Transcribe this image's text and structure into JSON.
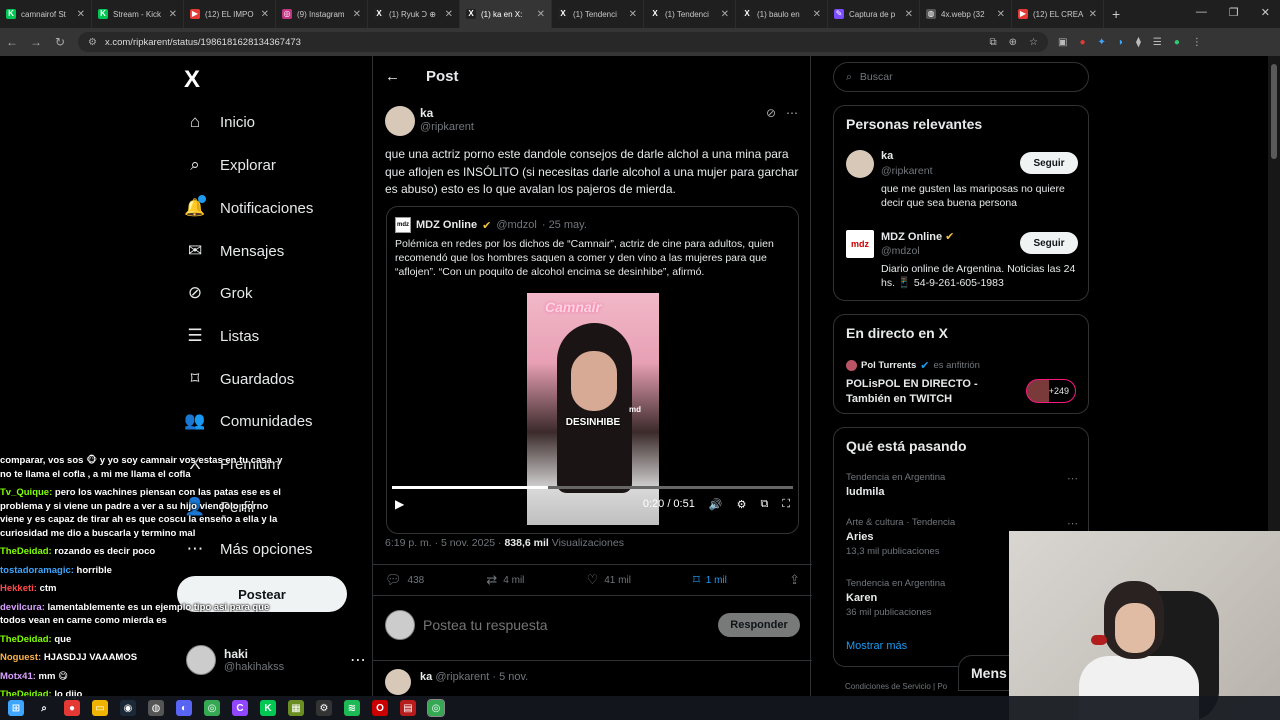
{
  "browser": {
    "tabs": [
      {
        "title": "camnairof St",
        "color": "#00c853",
        "glyph": "K"
      },
      {
        "title": "Stream - Kick",
        "color": "#00c853",
        "glyph": "K"
      },
      {
        "title": "(12) EL IMPO",
        "color": "#e53935",
        "glyph": "▶"
      },
      {
        "title": "(9) Instagram",
        "color": "#c13584",
        "glyph": "◎"
      },
      {
        "title": "(1) Ryuk Ↄ ⊕",
        "color": "#222222",
        "glyph": "X"
      },
      {
        "title": "(1) ka en X:",
        "color": "#222222",
        "glyph": "X",
        "active": true
      },
      {
        "title": "(1) Tendenci",
        "color": "#222222",
        "glyph": "X"
      },
      {
        "title": "(1) Tendenci",
        "color": "#222222",
        "glyph": "X"
      },
      {
        "title": "(1) baulo en",
        "color": "#222222",
        "glyph": "X"
      },
      {
        "title": "Captura de p",
        "color": "#7c4dff",
        "glyph": "✎"
      },
      {
        "title": "4x.webp (32",
        "color": "#555555",
        "glyph": "◍"
      },
      {
        "title": "(12) EL CREA",
        "color": "#e53935",
        "glyph": "▶"
      }
    ],
    "new_tab": "+",
    "window_controls": [
      "—",
      "❐",
      "✕"
    ],
    "url": "x.com/ripkarent/status/1986181628134367473"
  },
  "nav": {
    "logo": "X",
    "items": [
      {
        "label": "Inicio",
        "icon": "⌂",
        "name": "home"
      },
      {
        "label": "Explorar",
        "icon": "⌕",
        "name": "explore"
      },
      {
        "label": "Notificaciones",
        "icon": "🔔",
        "name": "notifications"
      },
      {
        "label": "Mensajes",
        "icon": "✉",
        "name": "messages"
      },
      {
        "label": "Grok",
        "icon": "⊘",
        "name": "grok"
      },
      {
        "label": "Listas",
        "icon": "☰",
        "name": "lists"
      },
      {
        "label": "Guardados",
        "icon": "⌑",
        "name": "bookmarks"
      },
      {
        "label": "Comunidades",
        "icon": "👥",
        "name": "communities"
      },
      {
        "label": "Premium",
        "icon": "X",
        "name": "premium"
      },
      {
        "label": "Perfil",
        "icon": "👤",
        "name": "profile"
      },
      {
        "label": "Más opciones",
        "icon": "⋯",
        "name": "more"
      }
    ],
    "post_button": "Postear",
    "profile": {
      "name": "haki",
      "handle": "@hakihakss",
      "more": "⋯"
    }
  },
  "chat": [
    {
      "user": "",
      "text": "comparar, vos sos 🐵 y yo soy camnair vos estas en tu casa, y no te llama el cofla , a mi me llama el cofla",
      "cls": ""
    },
    {
      "user": "Tv_Quique:",
      "text": "pero los wachines piensan con las patas ese es el problema y si viene un padre a ver a su hijo viendolo porno viene y es capaz de tirar ah es que coscu la enseño a ella y la curiosidad me dio a buscarla y termino mal",
      "cls": "cu-green"
    },
    {
      "user": "TheDeidad:",
      "text": "rozando es decir poco",
      "cls": "cu-green"
    },
    {
      "user": "tostadoramagic:",
      "text": "horrible",
      "cls": "cu-blue"
    },
    {
      "user": "Hekketi:",
      "text": "ctm",
      "cls": "cu-red"
    },
    {
      "user": "devilcura:",
      "text": "lamentablemente es un ejemplo tipo asi para que todos vean en carne como mierda es",
      "cls": "cu-purple"
    },
    {
      "user": "TheDeidad:",
      "text": "que",
      "cls": "cu-green"
    },
    {
      "user": "Noguest:",
      "text": "HJASDJJ VAAAMOS",
      "cls": "cu-orange"
    },
    {
      "user": "Motx41:",
      "text": "mm 😋",
      "cls": "cu-purple"
    },
    {
      "user": "TheDeidad:",
      "text": "lo dijo",
      "cls": "cu-green"
    }
  ],
  "main": {
    "header": {
      "back": "←",
      "title": "Post"
    },
    "tweet": {
      "name": "ka",
      "handle": "@ripkarent",
      "text": "que una actriz porno este dandole consejos de darle alchol a una mina para que aflojen es INSÓLITO (si necesitas darle alcohol a una mujer para garchar es abuso) esto es lo que avalan los pajeros de mierda.",
      "grok_icon": "⊘",
      "more": "⋯"
    },
    "quote": {
      "logo": "mdz",
      "name": "MDZ Online",
      "verified": "✔",
      "handle": "@mdzol",
      "date": "· 25 may.",
      "text": "Polémica en redes por los dichos de “Camnair”, actriz de cine para adultos, quien recomendó que los hombres saquen a comer y den vino a las mujeres para que “aflojen”. “Con un poquito de alcohol encima se desinhibe”, afirmó.",
      "video": {
        "brand": "Camnair",
        "caption": "DESINHIBE",
        "badge": "md",
        "time": "0:20 / 0:51",
        "progress": 0.39
      }
    },
    "stats": {
      "time": "6:19 p. m. · 5 nov. 2025 ·",
      "views": "838,6 mil",
      "views_label": "Visualizaciones"
    },
    "actions": {
      "replies": "438",
      "reposts": "4 mil",
      "likes": "41 mil",
      "bookmarks": "1 mil"
    },
    "reply": {
      "placeholder": "Postea tu respuesta",
      "button": "Responder"
    },
    "next": {
      "name": "ka",
      "handle": "@ripkarent",
      "date": "· 5 nov."
    }
  },
  "right": {
    "search_placeholder": "Buscar",
    "people_title": "Personas relevantes",
    "people": [
      {
        "name": "ka",
        "handle": "@ripkarent",
        "bio": "que me gusten las mariposas no quiere decir que sea buena persona",
        "follow": "Seguir"
      },
      {
        "name": "MDZ Online",
        "handle": "@mdzol",
        "bio": "Diario online de Argentina. Noticias las 24 hs. 📱 54-9-261-605-1983",
        "follow": "Seguir",
        "logo": "mdz"
      }
    ],
    "live_title": "En directo en X",
    "live": {
      "host": "Pol Turrents",
      "host_suffix": "es anfitrión",
      "title": "POLisPOL EN DIRECTO - También en TWITCH",
      "count": "+249"
    },
    "trends_title": "Qué está pasando",
    "trends": [
      {
        "context": "Tendencia en Argentina",
        "name": "ludmila",
        "count": ""
      },
      {
        "context": "Arte & cultura · Tendencia",
        "name": "Aries",
        "count": "13,3 mil publicaciones"
      },
      {
        "context": "Tendencia en Argentina",
        "name": "Karen",
        "count": "36 mil publicaciones"
      }
    ],
    "show_more": "Mostrar más",
    "footer": "Condiciones de Servicio  |  Po"
  },
  "messages_pill": "Mens"
}
